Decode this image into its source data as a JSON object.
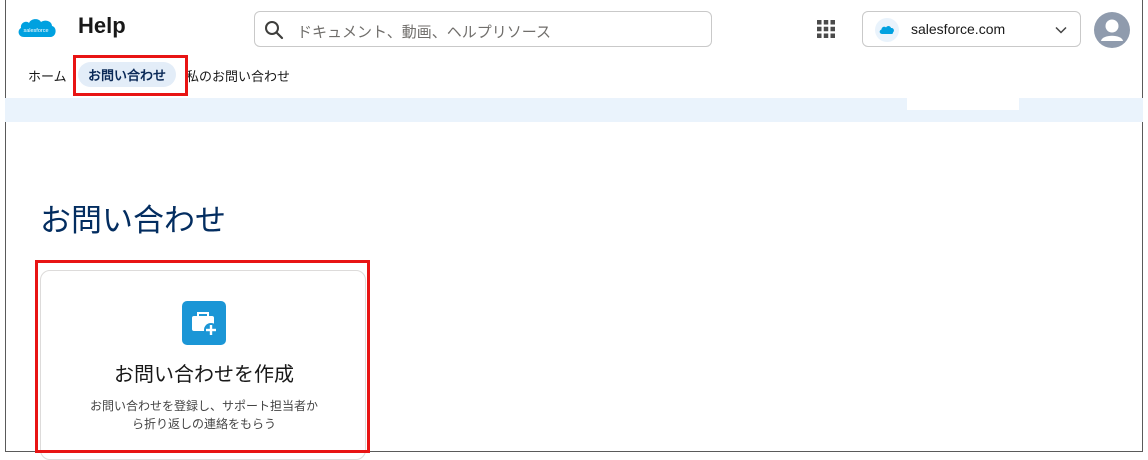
{
  "header": {
    "logo_text": "salesforce",
    "title": "Help",
    "search_placeholder": "ドキュメント、動画、ヘルプリソース",
    "org_label": "salesforce.com"
  },
  "nav": {
    "items": [
      {
        "label": "ホーム"
      },
      {
        "label": "お問い合わせ"
      },
      {
        "label": "私のお問い合わせ"
      }
    ]
  },
  "main": {
    "page_title": "お問い合わせ",
    "card": {
      "icon": "briefcase-plus-icon",
      "title": "お問い合わせを作成",
      "description_line1": "お問い合わせを登録し、サポート担当者か",
      "description_line2": "ら折り返しの連絡をもらう"
    }
  },
  "colors": {
    "brand": "#00a1e0",
    "highlight": "#e81414",
    "title_navy": "#032d60",
    "card_icon_bg": "#1b96d6"
  }
}
